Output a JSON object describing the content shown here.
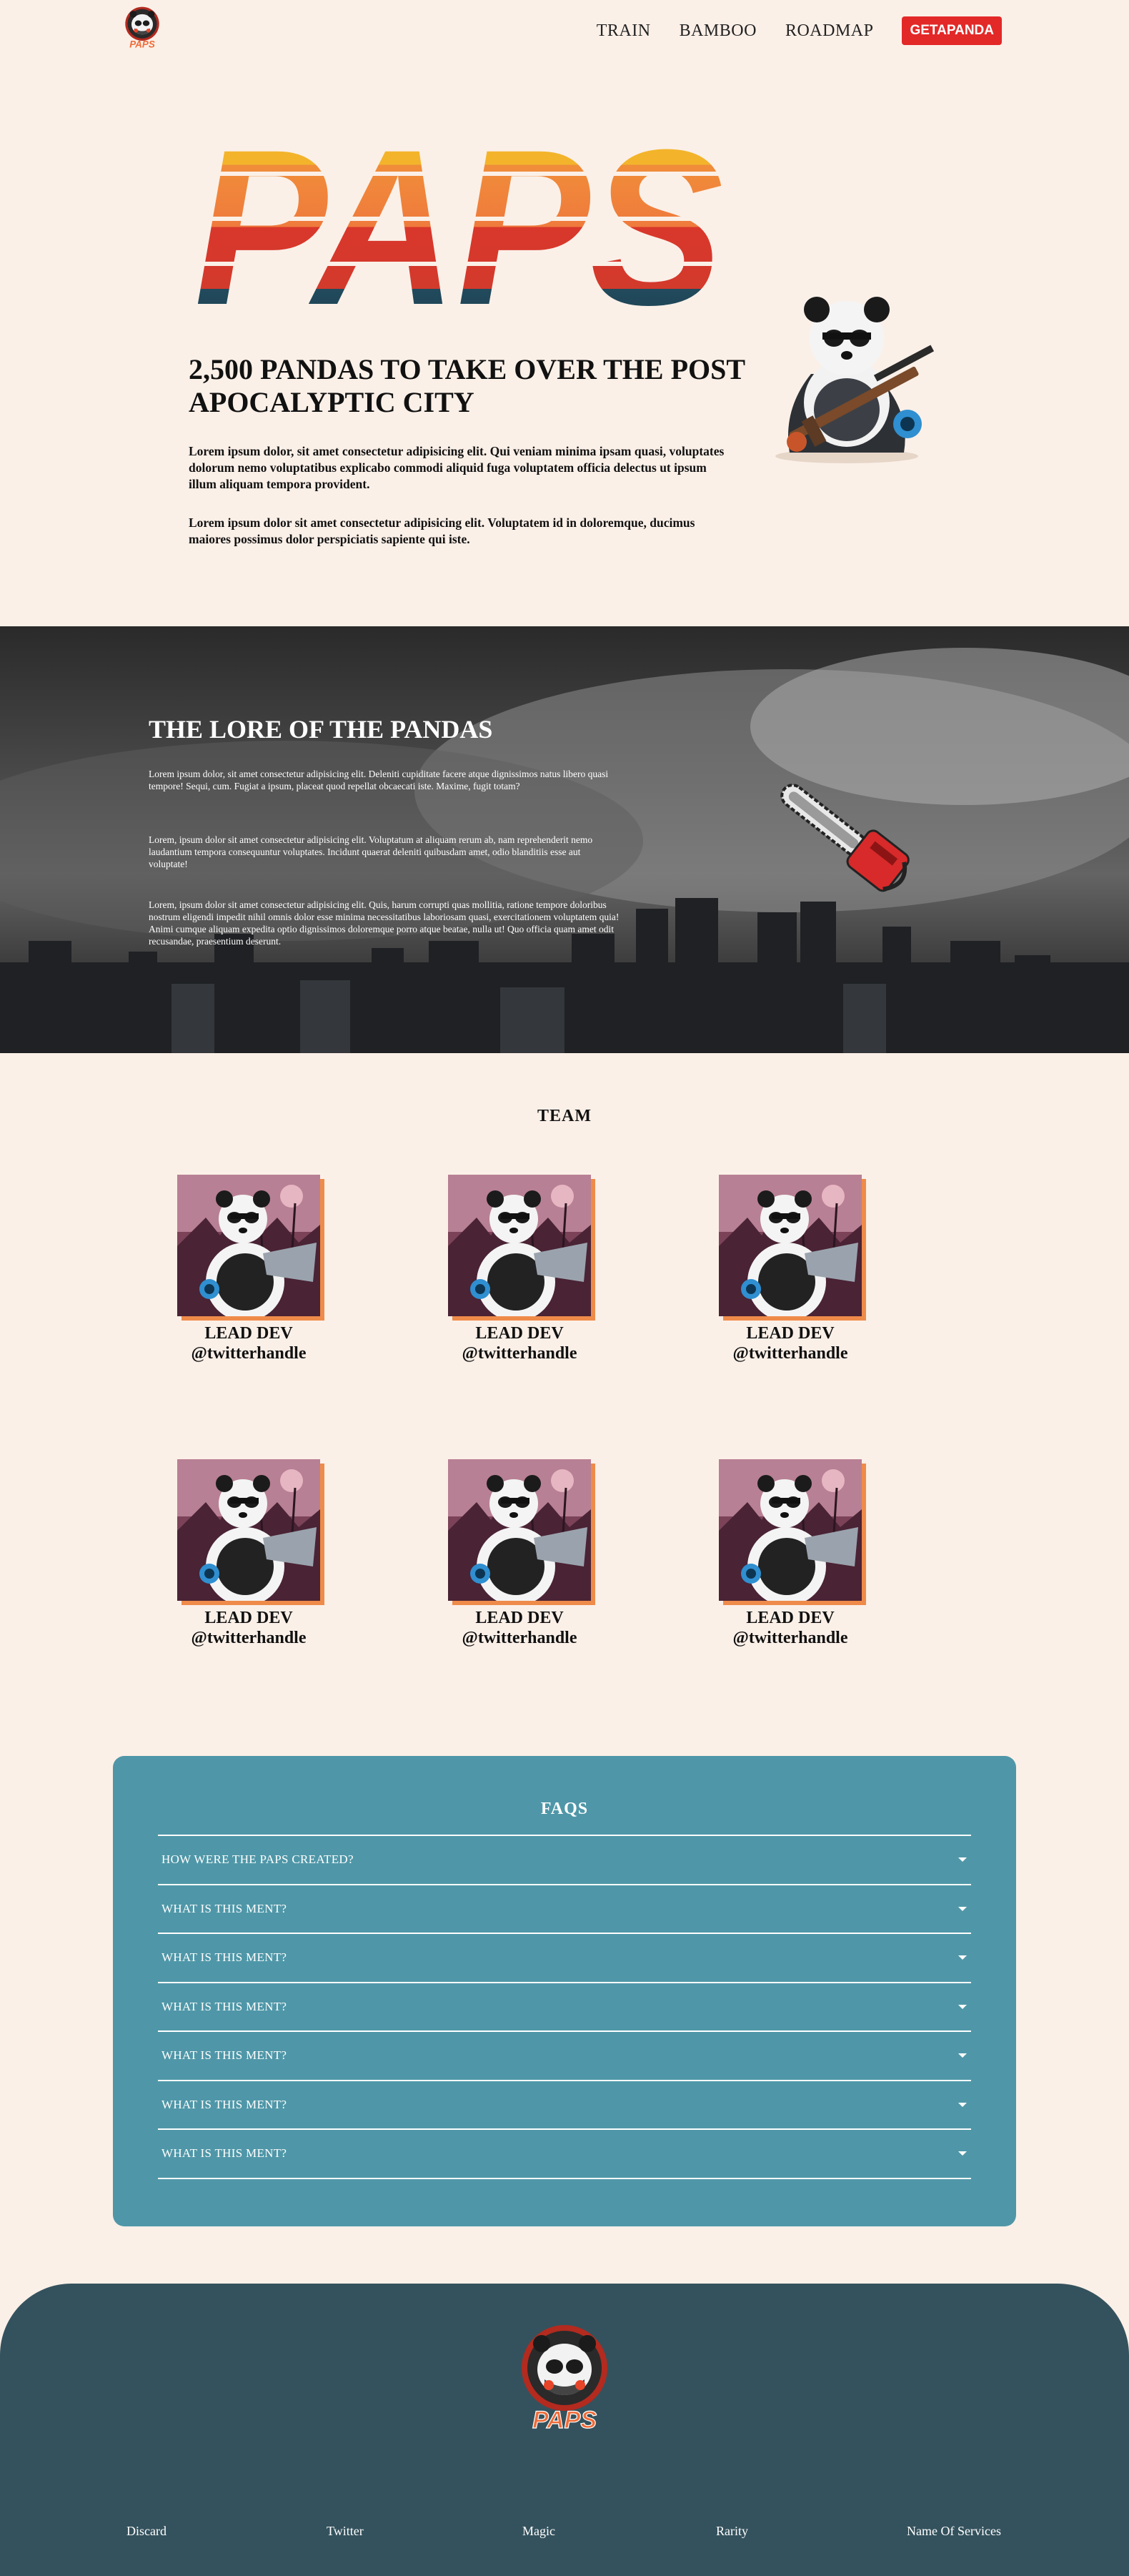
{
  "nav": {
    "logo_alt": "PAPS",
    "links": [
      "TRAIN",
      "BAMBOO",
      "ROADMAP"
    ],
    "cta": "GETAPANDA"
  },
  "hero": {
    "logo_text": "PAPS",
    "title": "2,500 PANDAS TO TAKE OVER THE POST APOCALYPTIC CITY",
    "p1": "Lorem ipsum dolor, sit amet consectetur adipisicing elit. Qui veniam minima ipsam quasi, voluptates dolorum nemo voluptatibus explicabo commodi aliquid fuga voluptatem officia delectus ut ipsum illum aliquam tempora provident.",
    "p2": "Lorem ipsum dolor sit amet consectetur adipisicing elit. Voluptatem id in doloremque, ducimus maiores possimus dolor perspiciatis sapiente qui iste."
  },
  "lore": {
    "title": "THE LORE OF THE PANDAS",
    "p1": "Lorem ipsum dolor, sit amet consectetur adipisicing elit. Deleniti cupiditate facere atque dignissimos natus libero quasi tempore! Sequi, cum. Fugiat a ipsum, placeat quod repellat obcaecati iste. Maxime, fugit totam?",
    "p2": "Lorem, ipsum dolor sit amet consectetur adipisicing elit. Voluptatum at aliquam rerum ab, nam reprehenderit nemo laudantium tempora consequuntur voluptates. Incidunt quaerat deleniti quibusdam amet, odio blanditiis esse aut voluptate!",
    "p3": "Lorem, ipsum dolor sit amet consectetur adipisicing elit. Quis, harum corrupti quas mollitia, ratione tempore doloribus nostrum eligendi impedit nihil omnis dolor esse minima necessitatibus laboriosam quasi, exercitationem voluptatem quia! Animi cumque aliquam expedita optio dignissimos doloremque porro atque beatae, nulla ut! Quo officia quam amet odit recusandae, praesentium deserunt."
  },
  "team": {
    "title": "TEAM",
    "members": [
      {
        "role": "LEAD DEV",
        "handle": "@twitterhandle"
      },
      {
        "role": "LEAD DEV",
        "handle": "@twitterhandle"
      },
      {
        "role": "LEAD DEV",
        "handle": "@twitterhandle"
      },
      {
        "role": "LEAD DEV",
        "handle": "@twitterhandle"
      },
      {
        "role": "LEAD DEV",
        "handle": "@twitterhandle"
      },
      {
        "role": "LEAD DEV",
        "handle": "@twitterhandle"
      }
    ]
  },
  "faq": {
    "title": "FAQS",
    "items": [
      "HOW WERE THE PAPS CREATED?",
      "WHAT IS THIS MENT?",
      "WHAT IS THIS MENT?",
      "WHAT IS THIS MENT?",
      "WHAT IS THIS MENT?",
      "WHAT IS THIS MENT?",
      "WHAT IS THIS MENT?"
    ]
  },
  "footer": {
    "logo_text": "PAPS",
    "links": [
      "Discard",
      "Twitter",
      "Magic",
      "Rarity",
      "Name Of Services"
    ]
  },
  "colors": {
    "page_bg": "#fbf0e8",
    "cta": "#e32828",
    "faq_bg": "#4f97a8",
    "footer_bg": "#34525d",
    "accent_shadow": "#ef8b4a"
  }
}
